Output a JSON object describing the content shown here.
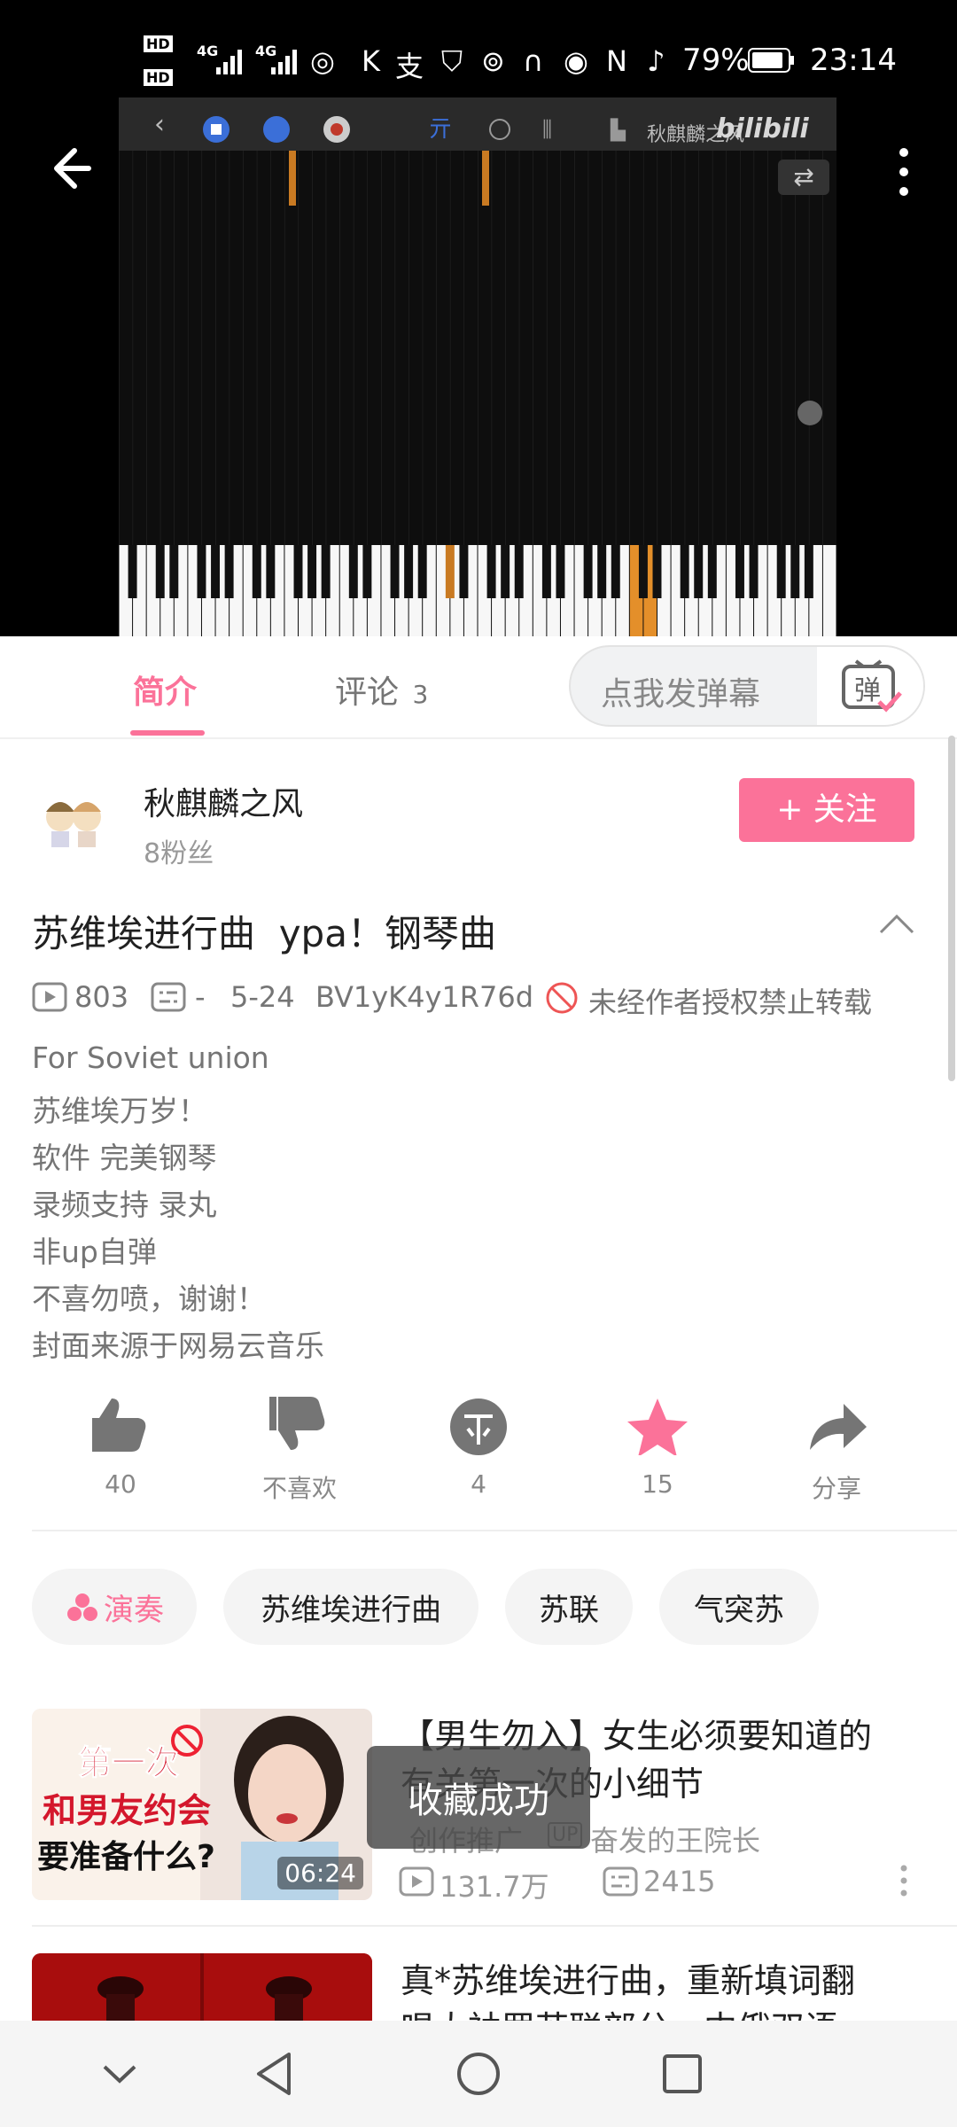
{
  "status_bar": {
    "hd1": "HD",
    "hd2": "HD",
    "net1": "4G",
    "net2": "4G",
    "battery": "79%",
    "time": "23:14"
  },
  "player": {
    "channel_watermark": "秋麒麟之风",
    "logo": "bilibili"
  },
  "tabs": {
    "intro": "简介",
    "comments": "评论",
    "comments_count": "3",
    "danmaku_placeholder": "点我发弹幕",
    "danmaku_button": "弹"
  },
  "uploader": {
    "name": "秋麒麟之风",
    "fans": "8粉丝",
    "follow": "+ 关注"
  },
  "video": {
    "title": "苏维埃进行曲  ура！钢琴曲",
    "views": "803",
    "danmaku": "-",
    "date": "5-24",
    "bvid": "BV1yK4y1R76d",
    "copyright": "未经作者授权禁止转载",
    "description": [
      "For Soviet union",
      "苏维埃万岁！",
      "软件 完美钢琴",
      "录频支持 录丸",
      "非up自弹",
      "不喜勿喷，谢谢！",
      "封面来源于网易云音乐"
    ]
  },
  "actions": {
    "like": "40",
    "dislike": "不喜欢",
    "coin": "4",
    "favorite": "15",
    "share": "分享"
  },
  "tags": [
    "演奏",
    "苏维埃进行曲",
    "苏联",
    "气突苏"
  ],
  "recommendations": [
    {
      "thumb_line1": "第一次",
      "thumb_line2": "和男友约会",
      "thumb_line3": "要准备什么?",
      "duration": "06:24",
      "title_line1": "【男生勿入】女生必须要知道的",
      "title_line2": "有关第一次的小细节",
      "badge": "创作推广",
      "up_label": "UP",
      "author": "奋发的王院长",
      "views": "131.7万",
      "danmaku": "2415"
    },
    {
      "title_line1": "真*苏维埃进行曲，重新填词翻",
      "title_line2": "唱大袖罗苏联部分，中俄双语"
    }
  ],
  "toast": "收藏成功",
  "colors": {
    "accent": "#fb7299",
    "muted": "#757575",
    "toast_bg": "#464646"
  },
  "icons": [
    "back-arrow-icon",
    "more-icon",
    "play-count-icon",
    "danmaku-count-icon",
    "forbid-icon",
    "collapse-icon",
    "like-icon",
    "dislike-icon",
    "coin-icon",
    "star-icon",
    "share-icon",
    "tag-music-icon",
    "nav-back-icon",
    "nav-home-icon",
    "nav-recent-icon"
  ]
}
